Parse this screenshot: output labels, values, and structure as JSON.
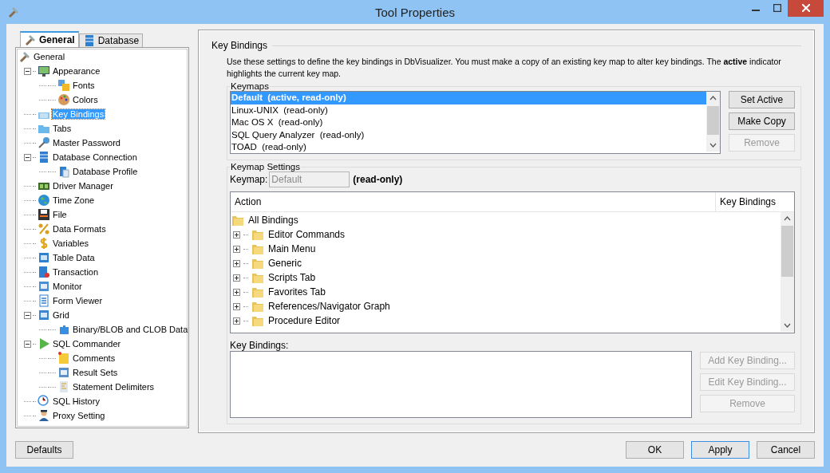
{
  "window": {
    "title": "Tool Properties"
  },
  "left_tabs": [
    {
      "label": "General",
      "selected": true
    },
    {
      "label": "Database",
      "selected": false
    }
  ],
  "tree": [
    {
      "label": "General",
      "selected": false,
      "children": [
        {
          "label": "Appearance",
          "selected": false,
          "expanded": true,
          "children": [
            {
              "label": "Fonts",
              "selected": false
            },
            {
              "label": "Colors",
              "selected": false
            }
          ]
        },
        {
          "label": "Key Bindings",
          "selected": true
        },
        {
          "label": "Tabs",
          "selected": false
        },
        {
          "label": "Master Password",
          "selected": false
        },
        {
          "label": "Database Connection",
          "selected": false,
          "expanded": true,
          "children": [
            {
              "label": "Database Profile",
              "selected": false
            }
          ]
        },
        {
          "label": "Driver Manager",
          "selected": false
        },
        {
          "label": "Time Zone",
          "selected": false
        },
        {
          "label": "File",
          "selected": false
        },
        {
          "label": "Data Formats",
          "selected": false
        },
        {
          "label": "Variables",
          "selected": false
        },
        {
          "label": "Table Data",
          "selected": false
        },
        {
          "label": "Transaction",
          "selected": false
        },
        {
          "label": "Monitor",
          "selected": false
        },
        {
          "label": "Form Viewer",
          "selected": false
        },
        {
          "label": "Grid",
          "selected": false,
          "expanded": true,
          "children": [
            {
              "label": "Binary/BLOB and CLOB Data",
              "selected": false
            }
          ]
        },
        {
          "label": "SQL Commander",
          "selected": false,
          "expanded": true,
          "children": [
            {
              "label": "Comments",
              "selected": false
            },
            {
              "label": "Result Sets",
              "selected": false
            },
            {
              "label": "Statement Delimiters",
              "selected": false
            }
          ]
        },
        {
          "label": "SQL History",
          "selected": false
        },
        {
          "label": "Proxy Setting",
          "selected": false
        }
      ]
    }
  ],
  "defaults_button": {
    "label": "Defaults"
  },
  "section": {
    "title": "Key Bindings",
    "description": "Use these settings to define the key bindings in DbVisualizer. You must make a copy of an existing key map to alter key bindings. The **active** indicator highlights the current key map."
  },
  "keymaps": {
    "title": "Keymaps",
    "items": [
      {
        "label": "Default  (active, read-only)",
        "selected": true
      },
      {
        "label": "Linux-UNIX  (read-only)",
        "selected": false
      },
      {
        "label": "Mac OS X  (read-only)",
        "selected": false
      },
      {
        "label": "SQL Query Analyzer  (read-only)",
        "selected": false
      },
      {
        "label": "TOAD  (read-only)",
        "selected": false
      }
    ],
    "buttons": [
      {
        "label": "Set Active",
        "disabled": false
      },
      {
        "label": "Make Copy",
        "disabled": false
      },
      {
        "label": "Remove",
        "disabled": true
      }
    ]
  },
  "keymap_settings": {
    "title": "Keymap Settings",
    "keymap_label": "Keymap:",
    "keymap_value": "Default",
    "keymap_note": "(read-only)",
    "columns": [
      "Action",
      "Key Bindings"
    ],
    "actions": {
      "label": "All Bindings",
      "children": [
        {
          "label": "Editor Commands",
          "expanded": false
        },
        {
          "label": "Main Menu",
          "expanded": false
        },
        {
          "label": "Generic",
          "expanded": false
        },
        {
          "label": "Scripts Tab",
          "expanded": false
        },
        {
          "label": "Favorites Tab",
          "expanded": false
        },
        {
          "label": "References/Navigator Graph",
          "expanded": false
        },
        {
          "label": "Procedure Editor",
          "expanded": false
        }
      ]
    },
    "bindings_label": "Key Bindings:",
    "buttons": [
      {
        "label": "Add Key Binding...",
        "disabled": true
      },
      {
        "label": "Edit Key Binding...",
        "disabled": true
      },
      {
        "label": "Remove",
        "disabled": true
      }
    ]
  },
  "footer_buttons": [
    {
      "label": "OK",
      "focused": false
    },
    {
      "label": "Apply",
      "focused": true
    },
    {
      "label": "Cancel",
      "focused": false
    }
  ]
}
